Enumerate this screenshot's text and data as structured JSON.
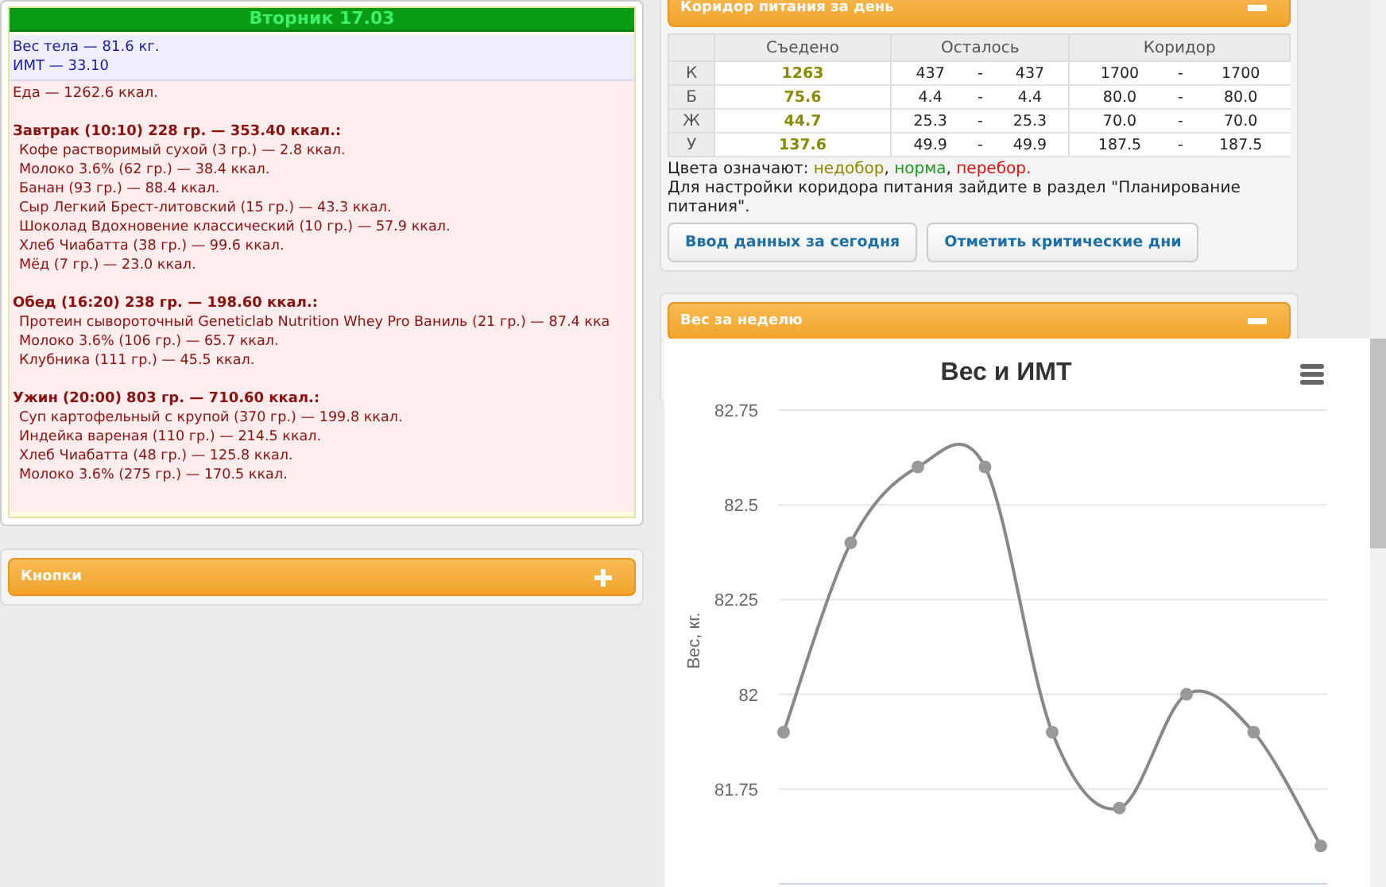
{
  "day_panel": {
    "title": "Вторник 17.03",
    "body_stats": [
      "Вес тела — 81.6 кг.",
      "ИМТ — 33.10"
    ],
    "food_total": "Еда — 1262.6 ккал.",
    "meals": [
      {
        "title": "Завтрак (10:10) 228 гр. — 353.40 ккал.:",
        "items": [
          "Кофе растворимый сухой (3 гр.) — 2.8 ккал.",
          "Молоко 3.6% (62 гр.) — 38.4 ккал.",
          "Банан (93 гр.) — 88.4 ккал.",
          "Сыр Легкий Брест-литовский (15 гр.) — 43.3 ккал.",
          "Шоколад Вдохновение классический (10 гр.) — 57.9 ккал.",
          "Хлеб Чиабатта (38 гр.) — 99.6 ккал.",
          "Мёд (7 гр.) — 23.0 ккал."
        ]
      },
      {
        "title": "Обед (16:20) 238 гр. — 198.60 ккал.:",
        "items": [
          "Протеин сывороточный Geneticlab Nutrition Whey Pro Ваниль (21 гр.) — 87.4 кка",
          "Молоко 3.6% (106 гр.) — 65.7 ккал.",
          "Клубника (111 гр.) — 45.5 ккал."
        ]
      },
      {
        "title": "Ужин (20:00) 803 гр. — 710.60 ккал.:",
        "items": [
          "Суп картофельный с крупой (370 гр.) — 199.8 ккал.",
          "Индейка вареная (110 гр.) — 214.5 ккал.",
          "Хлеб Чиабатта (48 гр.) — 125.8 ккал.",
          "Молоко 3.6% (275 гр.) — 170.5 ккал."
        ]
      }
    ]
  },
  "buttons_panel": {
    "title": "Кнопки",
    "expanded": false
  },
  "corridor_panel": {
    "title": "Коридор питания за день",
    "expanded": true,
    "table": {
      "columns": [
        "Съедено",
        "Осталось",
        "Коридор"
      ],
      "rows": [
        {
          "label": "К",
          "eaten": "1263",
          "color": "#8a8a00",
          "left_min": "437",
          "left_sep": "-",
          "left_max": "437",
          "corr_min": "1700",
          "corr_sep": "-",
          "corr_max": "1700"
        },
        {
          "label": "Б",
          "eaten": "75.6",
          "color": "#8a8a00",
          "left_min": "4.4",
          "left_sep": "-",
          "left_max": "4.4",
          "corr_min": "80.0",
          "corr_sep": "-",
          "corr_max": "80.0"
        },
        {
          "label": "Ж",
          "eaten": "44.7",
          "color": "#8a8a00",
          "left_min": "25.3",
          "left_sep": "-",
          "left_max": "25.3",
          "corr_min": "70.0",
          "corr_sep": "-",
          "corr_max": "70.0"
        },
        {
          "label": "У",
          "eaten": "137.6",
          "color": "#8a8a00",
          "left_min": "49.9",
          "left_sep": "-",
          "left_max": "49.9",
          "corr_min": "187.5",
          "corr_sep": "-",
          "corr_max": "187.5"
        }
      ]
    },
    "legend": [
      {
        "text": "Цвета означают: ",
        "color": "#222222"
      },
      {
        "text": "недобор",
        "color": "#8a8a00"
      },
      {
        "text": ", ",
        "color": "#222222"
      },
      {
        "text": "норма",
        "color": "#1a9a1a"
      },
      {
        "text": ", ",
        "color": "#222222"
      },
      {
        "text": "перебор.",
        "color": "#e01010"
      }
    ],
    "note": "Для настройки коридора питания зайдите в раздел \"Планирование питания\".",
    "buttons": [
      "Ввод данных за сегодня",
      "Отметить критические дни"
    ]
  },
  "weight_panel": {
    "title": "Вес за неделю",
    "expanded": true,
    "chart_data": {
      "type": "line",
      "title": "Вес и ИМТ",
      "ylabel": "Вес, кг.",
      "values": [
        81.9,
        82.4,
        82.6,
        82.6,
        81.9,
        81.7,
        82.0,
        81.9,
        81.6
      ],
      "ylim": [
        81.5,
        82.75
      ],
      "grid": true,
      "marker": true,
      "yticks": [
        {
          "value": 81.75,
          "label": "81.75"
        },
        {
          "value": 82,
          "label": "82"
        },
        {
          "value": 82.25,
          "label": "82.25"
        },
        {
          "value": 82.5,
          "label": "82.5"
        },
        {
          "value": 82.75,
          "label": "82.75"
        }
      ]
    }
  }
}
